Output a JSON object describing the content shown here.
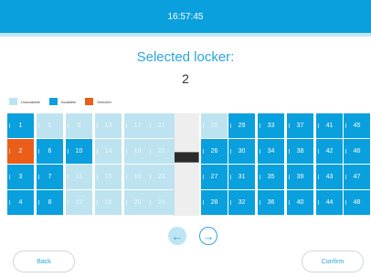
{
  "header": {
    "time": "16:57:45"
  },
  "selection": {
    "title": "Selected locker:",
    "number": "2"
  },
  "legend": [
    {
      "label": "Unavailable",
      "color": "#bde3f0"
    },
    {
      "label": "Available",
      "color": "#0aa0de"
    },
    {
      "label": "Selected",
      "color": "#ea5e1a"
    }
  ],
  "lockers": {
    "columns": [
      [
        "1",
        "2",
        "3",
        "4"
      ],
      [
        "5",
        "6",
        "7",
        "8"
      ],
      [
        "9",
        "10",
        "11",
        "12"
      ],
      [
        "13",
        "14",
        "15",
        "16"
      ],
      [
        "17",
        "18",
        "19",
        "20"
      ],
      [
        "21",
        "22",
        "23",
        "24"
      ],
      [
        "25",
        "26",
        "27",
        "28"
      ],
      [
        "29",
        "30",
        "31",
        "32"
      ],
      [
        "33",
        "34",
        "35",
        "36"
      ],
      [
        "37",
        "38",
        "39",
        "40"
      ],
      [
        "41",
        "42",
        "43",
        "44"
      ],
      [
        "45",
        "46",
        "47",
        "48"
      ]
    ],
    "unavailable": [
      "5",
      "9",
      "11",
      "12",
      "13",
      "14",
      "15",
      "16",
      "17",
      "18",
      "19",
      "20",
      "21",
      "22",
      "23",
      "24",
      "25"
    ],
    "selected": "2"
  },
  "nav": {
    "prev_icon": "arrow-left-icon",
    "next_icon": "arrow-right-icon"
  },
  "buttons": {
    "back": "Back",
    "confirm": "Confirm"
  }
}
